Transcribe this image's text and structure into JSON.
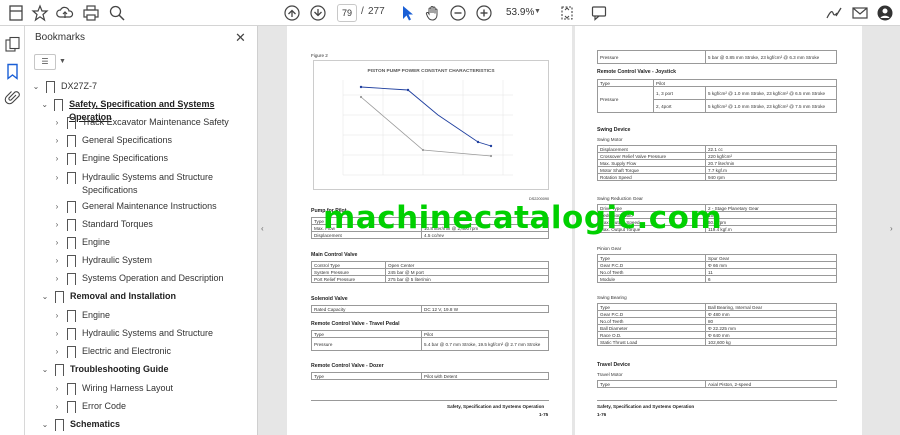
{
  "toolbar": {
    "page_current": "79",
    "page_separator": "/",
    "page_total": "277",
    "zoom": "53.9%"
  },
  "bookmarks": {
    "title": "Bookmarks",
    "items": [
      {
        "label": "DX27Z-7",
        "level": 0,
        "bold": false
      },
      {
        "label": "Safety, Specification and Systems Operation",
        "level": 1,
        "bold": true
      },
      {
        "label": "Track Excavator Maintenance Safety",
        "level": 2,
        "bold": false
      },
      {
        "label": "General Specifications",
        "level": 2,
        "bold": false
      },
      {
        "label": "Engine Specifications",
        "level": 2,
        "bold": false
      },
      {
        "label": "Hydraulic Systems and Structure",
        "label2": "Specifications",
        "level": 2,
        "bold": false
      },
      {
        "label": "General Maintenance Instructions",
        "level": 2,
        "bold": false
      },
      {
        "label": "Standard Torques",
        "level": 2,
        "bold": false
      },
      {
        "label": "Engine",
        "level": 2,
        "bold": false
      },
      {
        "label": "Hydraulic System",
        "level": 2,
        "bold": false
      },
      {
        "label": "Systems Operation and Description",
        "level": 2,
        "bold": false
      },
      {
        "label": "Removal and Installation",
        "level": 1,
        "bold": true
      },
      {
        "label": "Engine",
        "level": 2,
        "bold": false
      },
      {
        "label": "Hydraulic Systems and Structure",
        "level": 2,
        "bold": false
      },
      {
        "label": "Electric and Electronic",
        "level": 2,
        "bold": false
      },
      {
        "label": "Troubleshooting Guide",
        "level": 1,
        "bold": true
      },
      {
        "label": "Wiring Harness Layout",
        "level": 2,
        "bold": false
      },
      {
        "label": "Error Code",
        "level": 2,
        "bold": false
      },
      {
        "label": "Schematics",
        "level": 1,
        "bold": true
      }
    ]
  },
  "left_page": {
    "figure_label": "Figure 2",
    "figure_id": "DS2200090",
    "chart_title": "PISTON PUMP POWER CONSTANT CHARACTERISTICS",
    "pump_pilot_heading": "Pump for Pilot",
    "pump_pilot": [
      [
        "Type",
        ""
      ],
      [
        "Max. Flow",
        "10.8 liter/min @ 2,400 rpm"
      ],
      [
        "Displacement",
        "4.5 cc/rev"
      ]
    ],
    "main_control_heading": "Main Control Valve",
    "main_control": [
      [
        "Control Type",
        "Open Center"
      ],
      [
        "System Pressure",
        "245 bar @ M port"
      ],
      [
        "Port Relief Pressure",
        "275 bar @ 5 liter/min"
      ]
    ],
    "solenoid_heading": "Solenoid Valve",
    "solenoid": [
      [
        "Rated Capacity",
        "DC 12 V, 19.8 W"
      ]
    ],
    "rc_travel_heading": "Remote Control Valve - Travel Pedal",
    "rc_travel": [
      [
        "Type",
        "Pilot"
      ],
      [
        "Pressure",
        "5.4 bar @ 0.7 mm Stroke, 19.5 kgf/cm² @ 2.7 mm Stroke"
      ]
    ],
    "rc_dozer_heading": "Remote Control Valve - Dozer",
    "rc_dozer": [
      [
        "Type",
        "Pilot with Detent"
      ]
    ],
    "footer_title": "Safety, Specification and Systems Operation",
    "footer_page": "1-75"
  },
  "right_page": {
    "top_row": [
      "Pressure",
      "5 bar @ 0.85 mm Stroke, 23 kgf/cm² @ 6.3 mm Stroke"
    ],
    "joystick_heading": "Remote Control Valve - Joystick",
    "joystick_type": [
      "Type",
      "Pilot"
    ],
    "joystick_pressure_label": "Pressure",
    "joystick_pressure": [
      [
        "1, 3 port",
        "5 kgf/cm² @ 1.0 mm Stroke, 23 kgf/cm² @ 6.5 mm Stroke"
      ],
      [
        "2, 4port",
        "5 kgf/cm² @ 1.0 mm Stroke, 23 kgf/cm² @ 7.5 mm Stroke"
      ]
    ],
    "swing_device_heading": "Swing Device",
    "swing_motor_sub": "Swing Motor",
    "swing_motor": [
      [
        "Displacement",
        "22.1 cc"
      ],
      [
        "Crossover Relief Valve Pressure",
        "220 kgf/cm²"
      ],
      [
        "Max. Supply Flow",
        "20.7 liter/min"
      ],
      [
        "Motor Shaft Torque",
        "7.7 kgf.m"
      ],
      [
        "Rotation Speed",
        "940 rpm"
      ]
    ],
    "swing_reduction_sub": "Swing Reduction Gear",
    "swing_reduction": [
      [
        "Drive Type",
        "2 - Stage Planetary Gear"
      ],
      [
        "Reduction Ratio",
        "15.5"
      ],
      [
        "Max. Output Speed",
        "60.6 rpm"
      ],
      [
        "Max. Output Torque",
        "119.4 kgf.m"
      ]
    ],
    "pinion_sub": "Pinion Gear",
    "pinion": [
      [
        "Type",
        "Spur Gear"
      ],
      [
        "Gear P.C.D",
        "Φ 66 mm"
      ],
      [
        "No.of Teeth",
        "11"
      ],
      [
        "Module",
        "6"
      ]
    ],
    "bearing_sub": "Swing Bearing",
    "bearing": [
      [
        "Type",
        "Ball Bearing, Internal Gear"
      ],
      [
        "Gear P.C.D",
        "Φ 480 mm"
      ],
      [
        "No.of Teeth",
        "80"
      ],
      [
        "Ball Diameter",
        "Φ 22.225 mm"
      ],
      [
        "Race O.D.",
        "Φ 640 mm"
      ],
      [
        "Static Thrust Load",
        "102,600 kg"
      ]
    ],
    "travel_device_heading": "Travel Device",
    "travel_motor_sub": "Travel Motor",
    "travel_motor": [
      [
        "Type",
        "Axial Piston, 2-speed"
      ]
    ],
    "footer_title": "Safety, Specification and Systems Operation",
    "footer_page": "1-76"
  },
  "watermark": "machinecatalogic.com"
}
